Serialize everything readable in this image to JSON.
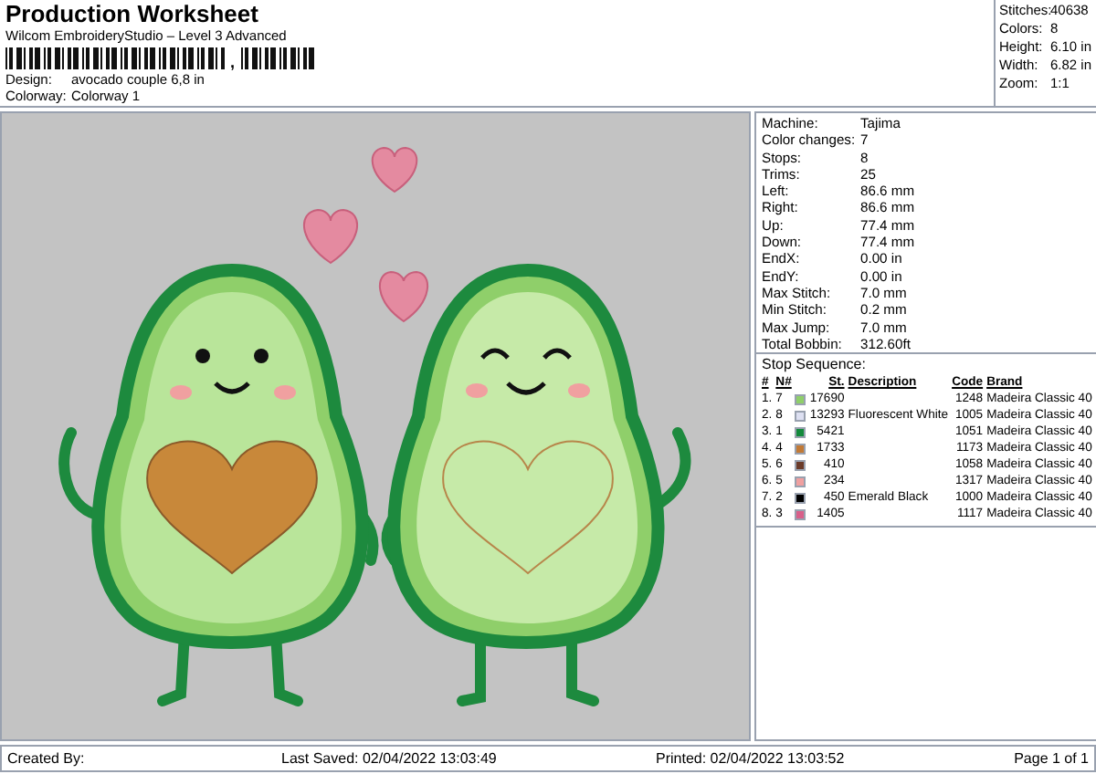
{
  "header": {
    "title": "Production Worksheet",
    "subtitle": "Wilcom EmbroideryStudio – Level 3 Advanced",
    "barcode_mark": ",",
    "fields": [
      {
        "label": "Design:",
        "value": "avocado couple 6,8 in"
      },
      {
        "label": "Colorway:",
        "value": "Colorway 1"
      }
    ]
  },
  "summary": [
    {
      "label": "Stitches:",
      "value": "40638"
    },
    {
      "label": "Colors:",
      "value": "8"
    },
    {
      "label": "Height:",
      "value": "6.10 in"
    },
    {
      "label": "Width:",
      "value": "6.82 in"
    },
    {
      "label": "Zoom:",
      "value": "1:1"
    }
  ],
  "machine_info": [
    {
      "label": "Machine:",
      "value": "Tajima"
    },
    {
      "label": "Color changes:",
      "value": "7"
    },
    {
      "label": "Stops:",
      "value": "8"
    },
    {
      "label": "Trims:",
      "value": "25"
    },
    {
      "label": "Left:",
      "value": "86.6 mm"
    },
    {
      "label": "Right:",
      "value": "86.6 mm"
    },
    {
      "label": "Up:",
      "value": "77.4 mm"
    },
    {
      "label": "Down:",
      "value": "77.4 mm"
    },
    {
      "label": "EndX:",
      "value": "0.00 in"
    },
    {
      "label": "EndY:",
      "value": "0.00 in"
    },
    {
      "label": "Max Stitch:",
      "value": "7.0 mm"
    },
    {
      "label": "Min Stitch:",
      "value": "0.2 mm"
    },
    {
      "label": "Max Jump:",
      "value": "7.0 mm"
    },
    {
      "label": "Total Bobbin:",
      "value": "312.60ft"
    }
  ],
  "stop_sequence": {
    "title": "Stop Sequence:",
    "columns": [
      "#",
      "N#",
      "St.",
      "Description",
      "Code",
      "Brand"
    ],
    "rows": [
      {
        "index": "1.",
        "needle": "7",
        "color": "#8fcf6a",
        "stitches": "17690",
        "description": "",
        "code": "1248",
        "brand": "Madeira Classic 40"
      },
      {
        "index": "2.",
        "needle": "8",
        "color": "#dde0f2",
        "stitches": "13293",
        "description": "Fluorescent White",
        "code": "1005",
        "brand": "Madeira Classic 40"
      },
      {
        "index": "3.",
        "needle": "1",
        "color": "#138a3c",
        "stitches": "5421",
        "description": "",
        "code": "1051",
        "brand": "Madeira Classic 40"
      },
      {
        "index": "4.",
        "needle": "4",
        "color": "#c27a36",
        "stitches": "1733",
        "description": "",
        "code": "1173",
        "brand": "Madeira Classic 40"
      },
      {
        "index": "5.",
        "needle": "6",
        "color": "#6b3b2a",
        "stitches": "410",
        "description": "",
        "code": "1058",
        "brand": "Madeira Classic 40"
      },
      {
        "index": "6.",
        "needle": "5",
        "color": "#f0a0a0",
        "stitches": "234",
        "description": "",
        "code": "1317",
        "brand": "Madeira Classic 40"
      },
      {
        "index": "7.",
        "needle": "2",
        "color": "#000000",
        "stitches": "450",
        "description": "Emerald Black",
        "code": "1000",
        "brand": "Madeira Classic 40"
      },
      {
        "index": "8.",
        "needle": "3",
        "color": "#d9608a",
        "stitches": "1405",
        "description": "",
        "code": "1117",
        "brand": "Madeira Classic 40"
      }
    ]
  },
  "footer": {
    "created_by": "Created By:",
    "last_saved": "Last Saved: 02/04/2022 13:03:49",
    "printed": "Printed: 02/04/2022 13:03:52",
    "page": "Page 1 of 1"
  }
}
